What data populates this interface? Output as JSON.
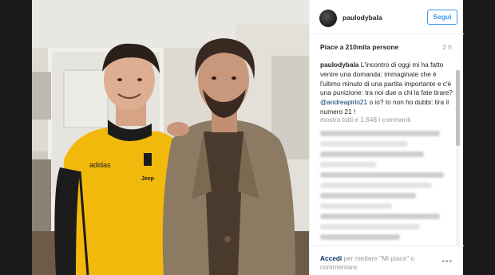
{
  "post": {
    "username": "paulodybala",
    "follow_label": "Segui",
    "likes_text": "Piace a 210mila persone",
    "time_ago": "2 h",
    "caption_user": "paulodybala",
    "caption_text_1": " L'incontro di oggi mi ha fatto venire una domanda: immaginate che è l'ultimo minuto di una partita importante e c'è una punizione: tra noi due a chi la fate tirare? ",
    "caption_mention": "@andreapirlo21",
    "caption_text_2": " o io? Io non ho dubbi: tira il numero 21 !",
    "show_all_comments": "mostra tutti e 1.648 i commenti",
    "footer_login": "Accedi",
    "footer_text": " per mettere \"Mi piace\" o commentare.",
    "more_icon": "ellipsis-icon"
  },
  "photo": {
    "jersey_brand": "adidas",
    "jersey_sponsor": "Jeep"
  }
}
